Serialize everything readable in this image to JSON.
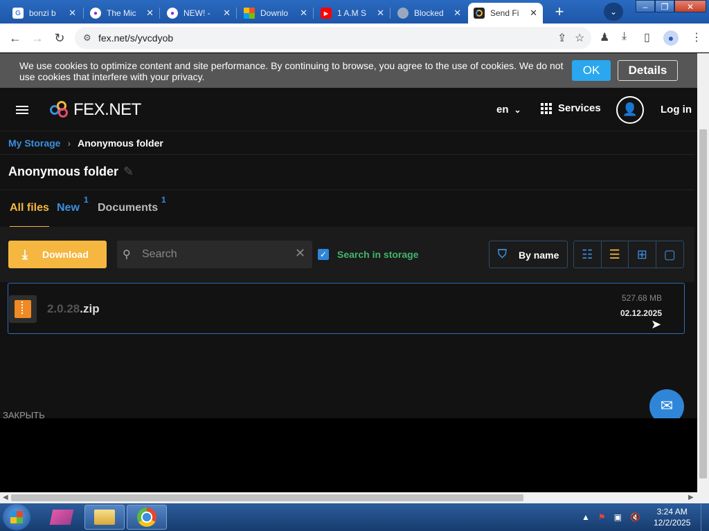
{
  "browser": {
    "tabs": [
      {
        "title": "bonzi b",
        "favicon": "google-icon",
        "color": "#4285f4",
        "glyph": "G"
      },
      {
        "title": "The Mic",
        "favicon": "circle-logo-icon",
        "color": "#8a2be2",
        "glyph": "●"
      },
      {
        "title": "NEW! -",
        "favicon": "circle-logo-icon",
        "color": "#8a2be2",
        "glyph": "●"
      },
      {
        "title": "Downlo",
        "favicon": "windows-logo-icon",
        "color": "#f25022",
        "glyph": "■"
      },
      {
        "title": "1 A.M S",
        "favicon": "youtube-icon",
        "color": "#ff0000",
        "glyph": "▶"
      },
      {
        "title": "Blocked",
        "favicon": "globe-icon",
        "color": "#9aa8bf",
        "glyph": "◍"
      },
      {
        "title": "Send Fi",
        "favicon": "fex-icon",
        "color": "#222222",
        "glyph": "◐",
        "active": true
      }
    ],
    "url": "fex.net/s/yvcdyob"
  },
  "cookie": {
    "text": "We use cookies to optimize content and site performance. By continuing to browse, you agree to the use of cookies. We do not use cookies that interfere with your privacy.",
    "ok": "OK",
    "details": "Details"
  },
  "header": {
    "logo": "FEX.NET",
    "lang": "en",
    "services": "Services",
    "login": "Log in"
  },
  "breadcrumb": {
    "root": "My Storage",
    "current": "Anonymous folder"
  },
  "folder": {
    "title": "Anonymous folder"
  },
  "tabs": {
    "all": "All files",
    "new": "New",
    "new_count": "1",
    "docs": "Documents",
    "docs_count": "1"
  },
  "controls": {
    "download": "Download",
    "search_placeholder": "Search",
    "search_in_storage": "Search in storage",
    "sort": "By name"
  },
  "file": {
    "name_prefix": "2.0.28",
    "name_ext": ".zip",
    "size": "527.68 MB",
    "date": "02.12.2025"
  },
  "footer": {
    "close": "ЗАКРЫТЬ"
  },
  "taskbar": {
    "time": "3:24 AM",
    "date": "12/2/2025"
  }
}
